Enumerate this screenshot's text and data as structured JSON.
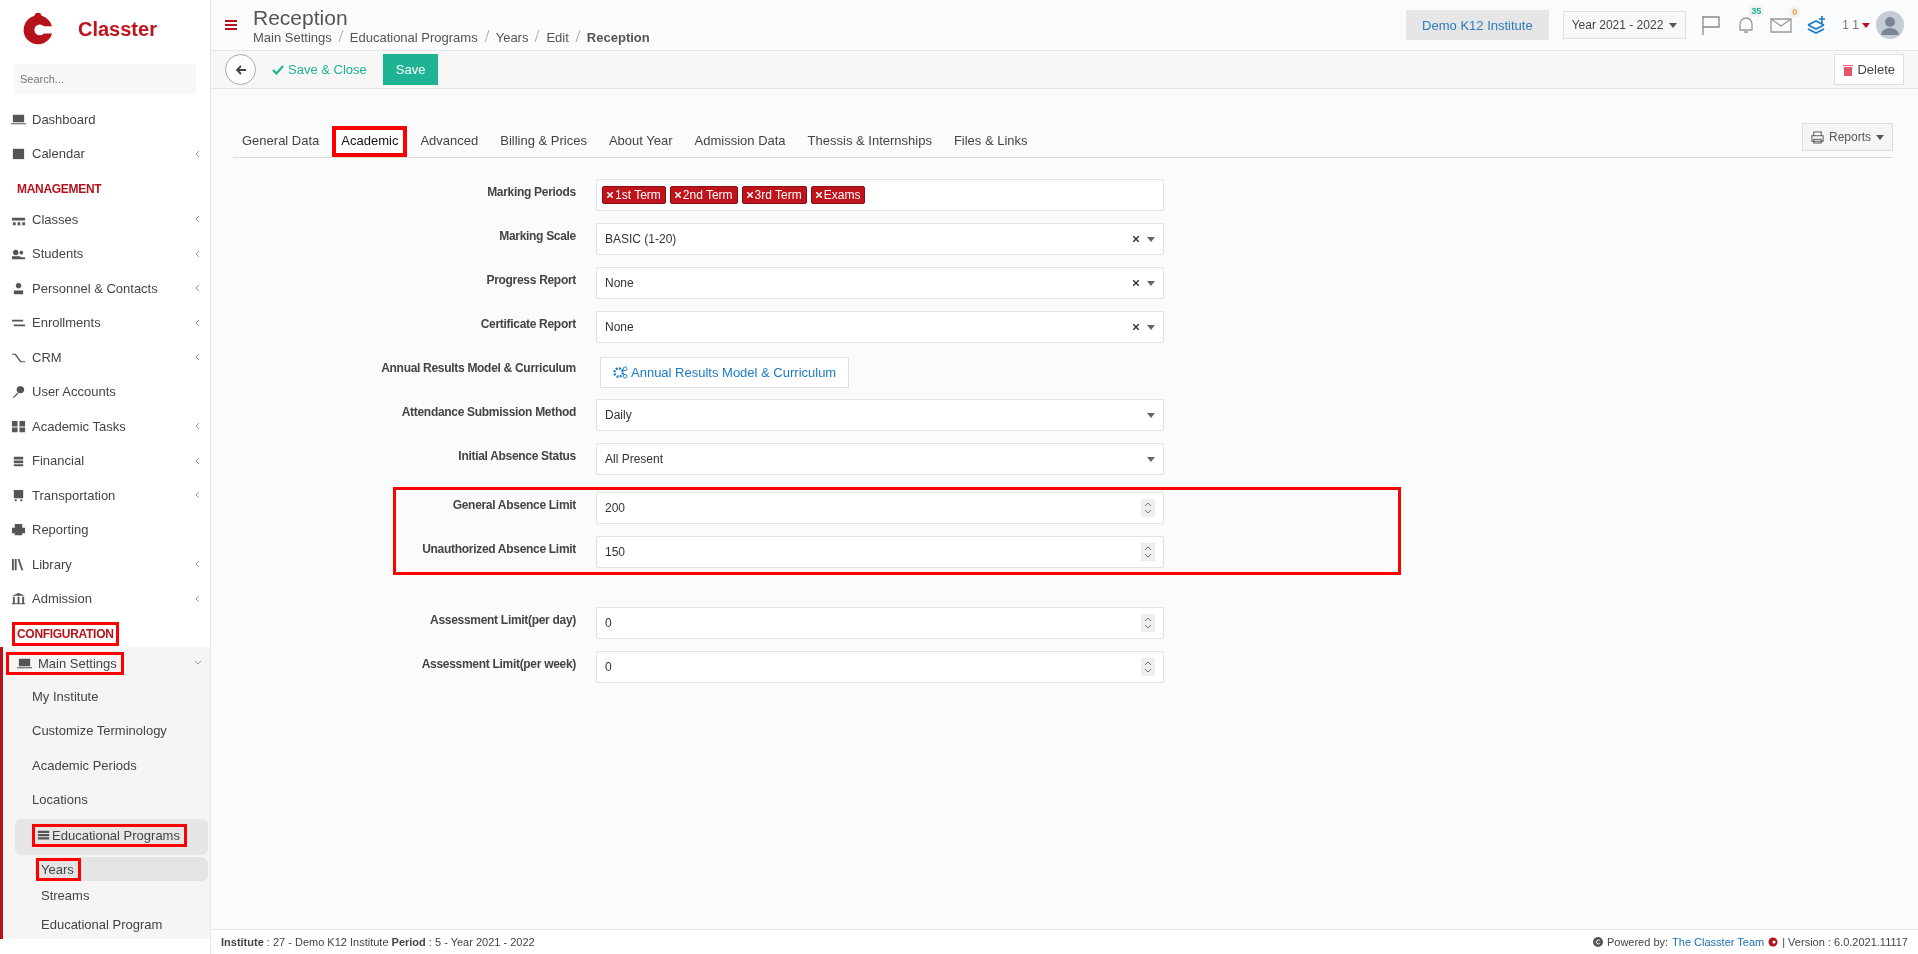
{
  "brand": {
    "name": "Classter"
  },
  "sidebar": {
    "search": {
      "placeholder": "Search..."
    },
    "sections": [
      {
        "items": [
          {
            "label": "Dashboard",
            "highlighted": false
          },
          {
            "label": "Calendar",
            "expanded": false,
            "highlighted": false
          }
        ]
      },
      {
        "heading": {
          "text": "MANAGEMENT",
          "highlighted": false
        },
        "items": [
          {
            "label": "Classes",
            "expanded": false,
            "highlighted": false
          },
          {
            "label": "Students",
            "expanded": false,
            "highlighted": false
          },
          {
            "label": "Personnel & Contacts",
            "expanded": false,
            "highlighted": false
          },
          {
            "label": "Enrollments",
            "expanded": false,
            "highlighted": false
          },
          {
            "label": "CRM",
            "expanded": false,
            "highlighted": false
          },
          {
            "label": "User Accounts",
            "highlighted": false
          },
          {
            "label": "Academic Tasks",
            "expanded": false,
            "highlighted": false
          },
          {
            "label": "Financial",
            "expanded": false,
            "highlighted": false
          },
          {
            "label": "Transportation",
            "expanded": false,
            "highlighted": false
          },
          {
            "label": "Reporting",
            "highlighted": false
          },
          {
            "label": "Library",
            "expanded": false,
            "highlighted": false
          },
          {
            "label": "Admission",
            "expanded": false,
            "highlighted": false
          }
        ]
      },
      {
        "heading": {
          "text": "CONFIGURATION",
          "highlighted": true
        },
        "items": [
          {
            "label": "Main Settings",
            "expanded": true,
            "highlighted": true,
            "children": [
              {
                "label": "My Institute",
                "selected": false,
                "highlighted": false
              },
              {
                "label": "Customize Terminology",
                "selected": false,
                "highlighted": false
              },
              {
                "label": "Academic Periods",
                "selected": false,
                "highlighted": false
              },
              {
                "label": "Locations",
                "selected": false,
                "highlighted": false
              },
              {
                "label": "Educational Programs",
                "selected": false,
                "expanded": true,
                "highlighted": true,
                "children": [
                  {
                    "label": "Years",
                    "selected": true,
                    "highlighted": true
                  },
                  {
                    "label": "Streams",
                    "selected": false,
                    "highlighted": false
                  },
                  {
                    "label": "Educational Program",
                    "selected": false,
                    "highlighted": false
                  }
                ]
              }
            ]
          }
        ]
      }
    ]
  },
  "header": {
    "title": "Reception",
    "breadcrumb": [
      "Main Settings",
      "Educational Programs",
      "Years",
      "Edit",
      "Reception"
    ],
    "institute": "Demo K12 Institute",
    "year": "Year 2021 - 2022",
    "notifications": "35",
    "messages": "0",
    "user": "1 1"
  },
  "toolbar": {
    "save_close": "Save & Close",
    "save": "Save",
    "delete": "Delete"
  },
  "tabs": [
    {
      "label": "General Data",
      "selected": false,
      "highlighted": false
    },
    {
      "label": "Academic",
      "selected": true,
      "highlighted": true
    },
    {
      "label": "Advanced",
      "selected": false,
      "highlighted": false
    },
    {
      "label": "Billing & Prices",
      "selected": false,
      "highlighted": false
    },
    {
      "label": "About Year",
      "selected": false,
      "highlighted": false
    },
    {
      "label": "Admission Data",
      "selected": false,
      "highlighted": false
    },
    {
      "label": "Thessis & Internships",
      "selected": false,
      "highlighted": false
    },
    {
      "label": "Files & Links",
      "selected": false,
      "highlighted": false
    }
  ],
  "reports": "Reports",
  "form_groups": [
    {
      "highlighted": false,
      "fields": [
        {
          "kind": "tags",
          "label": "Marking Periods",
          "tags": [
            "1st Term",
            "2nd Term",
            "3rd Term",
            "Exams"
          ]
        },
        {
          "kind": "select",
          "label": "Marking Scale",
          "value": "BASIC (1-20)",
          "clearable": true
        },
        {
          "kind": "select",
          "label": "Progress Report",
          "value": "None",
          "clearable": true
        },
        {
          "kind": "select",
          "label": "Certificate Report",
          "value": "None",
          "clearable": true
        },
        {
          "kind": "button",
          "label": "Annual Results Model & Curriculum",
          "value": "Annual Results Model & Curriculum"
        },
        {
          "kind": "select",
          "label": "Attendance Submission Method",
          "value": "Daily",
          "clearable": false
        },
        {
          "kind": "select",
          "label": "Initial Absence Status",
          "value": "All Present",
          "clearable": false
        }
      ]
    },
    {
      "highlighted": true,
      "fields": [
        {
          "kind": "number",
          "label": "General Absence Limit",
          "value": "200"
        },
        {
          "kind": "number",
          "label": "Unauthorized Absence Limit",
          "value": "150"
        }
      ]
    },
    {
      "highlighted": false,
      "fields": [
        {
          "kind": "number",
          "label": "Assessment Limit(per day)",
          "value": "0"
        },
        {
          "kind": "number",
          "label": "Assessment Limit(per week)",
          "value": "0"
        }
      ]
    }
  ],
  "footer": {
    "info": "**Institute** : 27 - Demo K12 Institute **Period** : 5 - Year 2021 - 2022",
    "powered": "Powered by:",
    "team": "The Classter Team",
    "version": "| Version : 6.0.2021.11117"
  }
}
